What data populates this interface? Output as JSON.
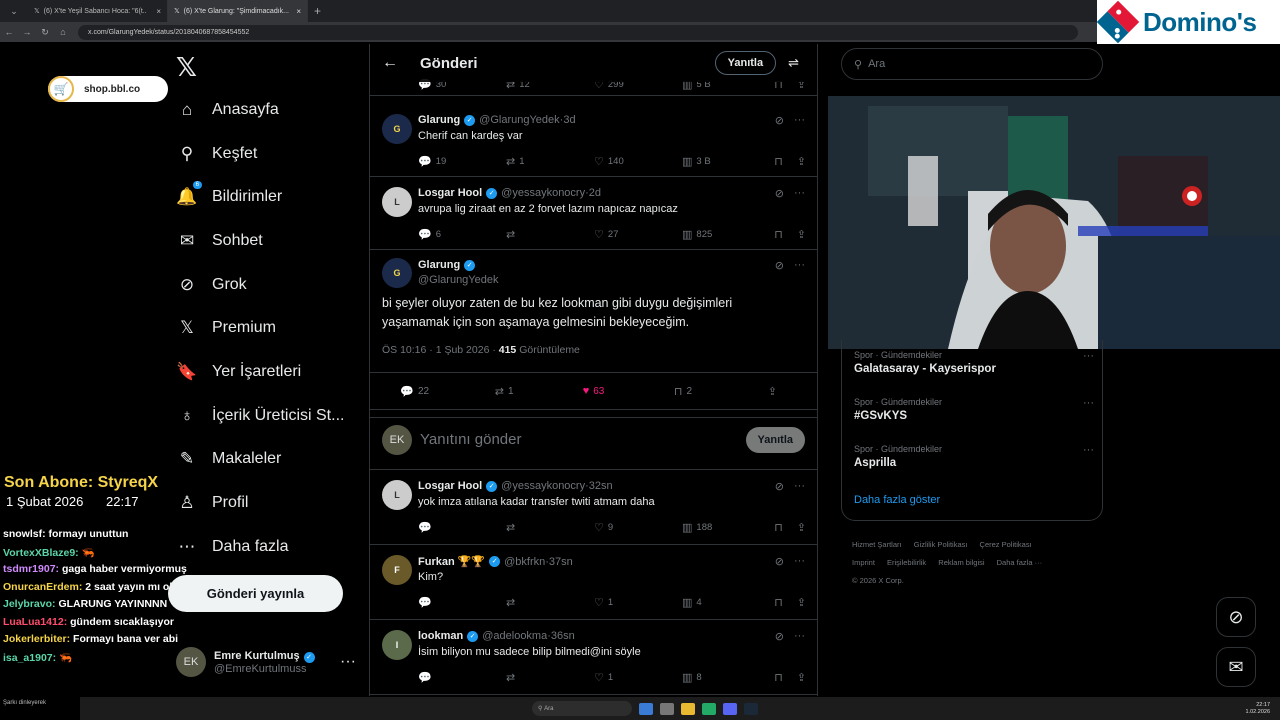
{
  "browser": {
    "tabs": [
      {
        "label": "(6) X'te Yeşil Sabancı Hoca: \"6(t.."
      },
      {
        "label": "(6) X'te Glarung: \"Şimdimacadık..."
      }
    ],
    "url": "x.com/GlarungYedek/status/2018040687858454552"
  },
  "ad": {
    "brand": "Domino's"
  },
  "overlay": {
    "shop": "shop.bbl.co",
    "last_sub_label": "Son Abone: StyreqX",
    "date": "1 Şubat 2026",
    "time": "22:17",
    "chat": [
      {
        "user": "snowlsf:",
        "msg": "formayı unuttun",
        "color": "#ffffff"
      },
      {
        "user": "VortexXBlaze9:",
        "msg": "🦐",
        "color": "#5bd6a8"
      },
      {
        "user": "tsdmr1907:",
        "msg": "gaga haber vermiyormuş",
        "color": "#d08bff"
      },
      {
        "user": "OnurcanErdem:",
        "msg": "2 saat yayın mı olur aq",
        "color": "#f5d44a"
      },
      {
        "user": "Jelybravo:",
        "msg": "GLARUNG YAYINNNN",
        "color": "#5bd6a8"
      },
      {
        "user": "LuaLua1412:",
        "msg": "gündem sıcaklaşıyor",
        "color": "#ff4d6d"
      },
      {
        "user": "Jokerlerbiter:",
        "msg": "Formayı bana ver abi",
        "color": "#f5d44a"
      },
      {
        "user": "isa_a1907:",
        "msg": "🦐",
        "color": "#5bd6a8"
      }
    ],
    "taskbar_song": "Şarkı dinleyerek"
  },
  "nav": {
    "items": [
      {
        "label": "Anasayfa",
        "icon": "home-icon",
        "glyph": "⌂"
      },
      {
        "label": "Keşfet",
        "icon": "search-icon",
        "glyph": "⚲"
      },
      {
        "label": "Bildirimler",
        "icon": "bell-icon",
        "glyph": "🔔"
      },
      {
        "label": "Sohbet",
        "icon": "mail-icon",
        "glyph": "✉"
      },
      {
        "label": "Grok",
        "icon": "grok-icon",
        "glyph": "⊘"
      },
      {
        "label": "Premium",
        "icon": "x-premium-icon",
        "glyph": "𝕏"
      },
      {
        "label": "Yer İşaretleri",
        "icon": "bookmark-icon",
        "glyph": "🔖"
      },
      {
        "label": "İçerik Üreticisi St...",
        "icon": "creator-icon",
        "glyph": "♁"
      },
      {
        "label": "Makaleler",
        "icon": "article-icon",
        "glyph": "✎"
      },
      {
        "label": "Profil",
        "icon": "profile-icon",
        "glyph": "♙"
      },
      {
        "label": "Daha fazla",
        "icon": "more-icon",
        "glyph": "⋯"
      }
    ],
    "notif_badge": "6",
    "post_button": "Gönderi yayınla",
    "account": {
      "name": "Emre Kurtulmuş",
      "handle": "@EmreKurtulmuss"
    }
  },
  "main": {
    "title": "Gönderi",
    "reply_pill": "Yanıtla",
    "prev_stats": {
      "replies": "30",
      "retweets": "12",
      "likes": "299",
      "views": "5 B"
    },
    "replies_above": [
      {
        "name": "Glarung",
        "handle": "@GlarungYedek",
        "time": "3d",
        "text": "Cherif can kardeş var",
        "replies": "19",
        "retweets": "1",
        "likes": "140",
        "views": "3 B"
      },
      {
        "name": "Losgar Hool",
        "handle": "@yessaykonocry",
        "time": "2d",
        "text": "avrupa lig ziraat en az 2 forvet lazım napıcaz napıcaz",
        "replies": "6",
        "retweets": "",
        "likes": "27",
        "views": "825"
      }
    ],
    "main_tweet": {
      "name": "Glarung",
      "handle": "@GlarungYedek",
      "text": "bi şeyler oluyor zaten de bu kez lookman gibi duygu değişimleri yaşamamak için son aşamaya gelmesini bekleyeceğim.",
      "time": "ÖS 10:16 · 1 Şub 2026 ·",
      "views": "415",
      "views_label": "Görüntüleme",
      "replies": "22",
      "retweets": "1",
      "likes": "63",
      "bookmarks": "2"
    },
    "reply_placeholder": "Yanıtını gönder",
    "reply_button": "Yanıtla",
    "replies_below": [
      {
        "name": "Losgar Hool",
        "handle": "@yessaykonocry",
        "time": "32sn",
        "text": "yok imza atılana kadar transfer twiti atmam daha",
        "replies": "",
        "retweets": "",
        "likes": "9",
        "views": "188"
      },
      {
        "name": "Furkan 🏆🏆",
        "handle": "@bkfrkn",
        "time": "37sn",
        "text": "Kim?",
        "replies": "",
        "retweets": "",
        "likes": "1",
        "views": "4"
      },
      {
        "name": "lookman",
        "handle": "@adelookma",
        "time": "36sn",
        "text": "İsim biliyon mu sadece bilip bilmedi@ini söyle",
        "replies": "",
        "retweets": "",
        "likes": "1",
        "views": "8"
      }
    ]
  },
  "right": {
    "search_placeholder": "Ara",
    "trends": [
      {
        "category": "Spor · Gündemdekiler",
        "title": "Galatasaray - Kayserispor"
      },
      {
        "category": "Spor · Gündemdekiler",
        "title": "#GSvKYS"
      },
      {
        "category": "Spor · Gündemdekiler",
        "title": "Asprilla"
      }
    ],
    "show_more": "Daha fazla göster",
    "footer_links": [
      "Hizmet Şartları",
      "Gizlilik Politikası",
      "Çerez Politikası",
      "Imprint",
      "Erişilebilirlik",
      "Reklam bilgisi",
      "Daha fazla ···"
    ],
    "copyright": "© 2026 X Corp."
  },
  "taskbar": {
    "search": "Ara",
    "clock_time": "22:17",
    "clock_date": "1.02.2026"
  }
}
